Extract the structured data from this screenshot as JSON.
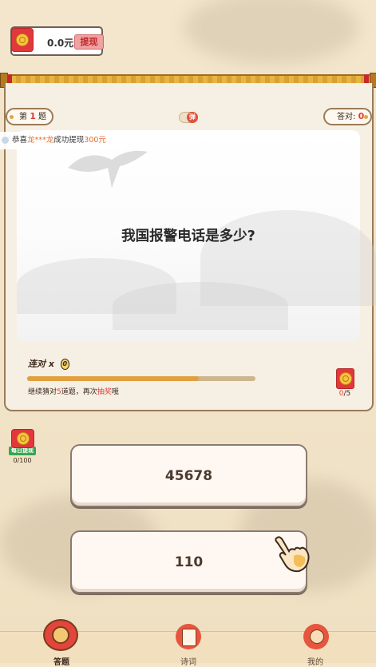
{
  "wallet": {
    "icon": "red-envelope-icon",
    "amount": "0.0元",
    "withdraw_label": "提现"
  },
  "header": {
    "question_no_prefix": "第",
    "question_no": "1",
    "question_no_suffix": "题",
    "bullet_label": "弹",
    "correct_label": "答对:",
    "correct_count": "0"
  },
  "marquee": {
    "prefix": "恭喜",
    "user": "龙***龙",
    "middle": "成功提现",
    "amount": "300元"
  },
  "question": {
    "text": "我国报警电话是多少?"
  },
  "streak": {
    "label": "连对",
    "times": "x",
    "count": "0",
    "progress": 0.75
  },
  "hint": {
    "prefix": "继续猜对",
    "count": "5",
    "middle": "道题，再次",
    "action": "抽奖",
    "suffix": "哦"
  },
  "side_reward": {
    "icon": "red-envelope-icon",
    "done": "0",
    "total": "/5"
  },
  "daily_withdraw": {
    "icon": "red-envelope-icon",
    "label": "每日提现",
    "count": "0/100"
  },
  "answers": [
    {
      "text": "45678"
    },
    {
      "text": "110"
    }
  ],
  "nav": [
    {
      "label": "答题",
      "icon": "quiz-drum-icon",
      "active": true
    },
    {
      "label": "诗词",
      "icon": "poem-scroll-icon",
      "active": false
    },
    {
      "label": "我的",
      "icon": "profile-god-of-wealth-icon",
      "active": false
    }
  ]
}
